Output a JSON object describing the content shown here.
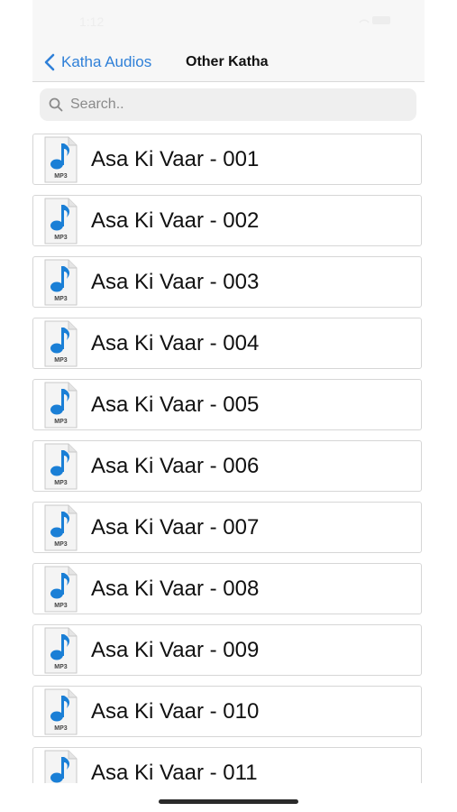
{
  "status_bar": {
    "time": "1:12"
  },
  "nav": {
    "back_label": "Katha Audios",
    "title": "Other Katha"
  },
  "search": {
    "placeholder": "Search.."
  },
  "file_icon_label": "MP3",
  "items": [
    {
      "label": "Asa Ki Vaar - 001"
    },
    {
      "label": "Asa Ki Vaar - 002"
    },
    {
      "label": "Asa Ki Vaar - 003"
    },
    {
      "label": "Asa Ki Vaar - 004"
    },
    {
      "label": "Asa Ki Vaar - 005"
    },
    {
      "label": "Asa Ki Vaar - 006"
    },
    {
      "label": "Asa Ki Vaar - 007"
    },
    {
      "label": "Asa Ki Vaar - 008"
    },
    {
      "label": "Asa Ki Vaar - 009"
    },
    {
      "label": "Asa Ki Vaar - 010"
    },
    {
      "label": "Asa Ki Vaar - 011"
    }
  ],
  "colors": {
    "accent": "#2f80d8",
    "note": "#1a7fd6"
  }
}
